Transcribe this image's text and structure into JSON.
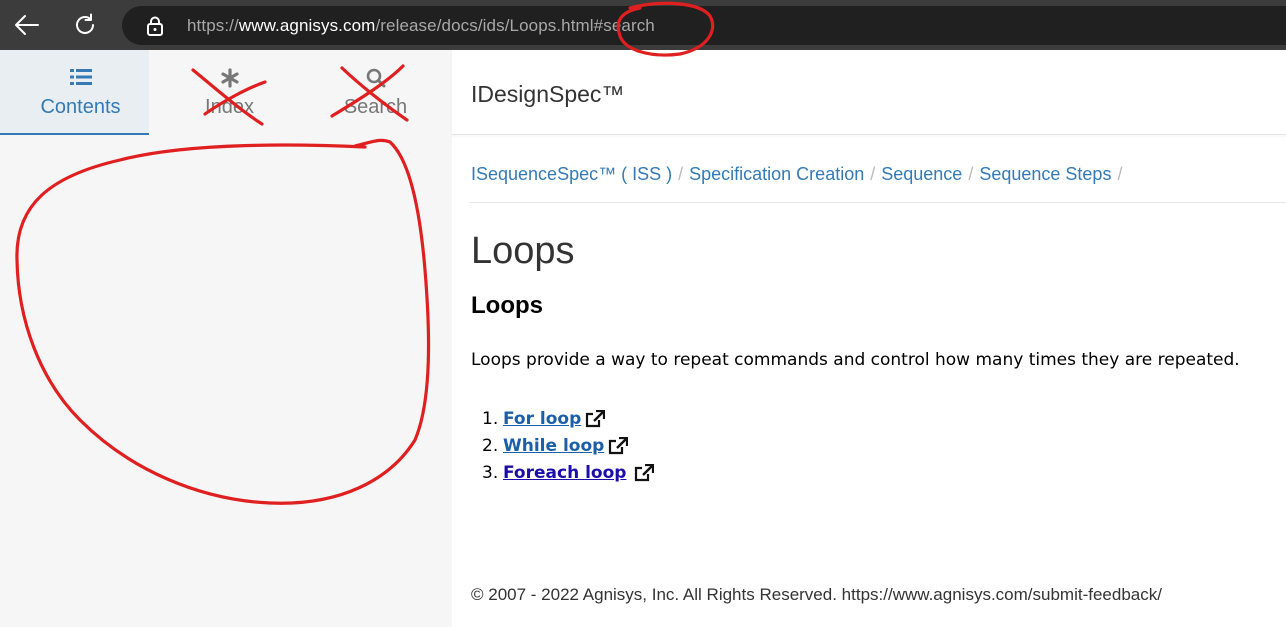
{
  "browser": {
    "url_prefix": "https://",
    "url_host": "www.agnisys.com",
    "url_path": "/release/docs/ids/Loops.html#search",
    "icons": [
      "back-arrow-icon",
      "reload-icon",
      "lock-icon"
    ]
  },
  "sidebar": {
    "tabs": [
      {
        "label": "Contents",
        "icon": "list-icon",
        "active": true
      },
      {
        "label": "Index",
        "icon": "asterisk-icon",
        "active": false
      },
      {
        "label": "Search",
        "icon": "search-icon",
        "active": false
      }
    ]
  },
  "header": {
    "title": "IDesignSpec™"
  },
  "breadcrumb": [
    "ISequenceSpec™ ( ISS )",
    "Specification Creation",
    "Sequence",
    "Sequence Steps"
  ],
  "page": {
    "title": "Loops",
    "section_title": "Loops",
    "intro": "Loops provide a way to repeat commands and control how many times they are repeated.",
    "list": [
      {
        "num": "1.",
        "label": "For loop ",
        "color": "#1a5fa8"
      },
      {
        "num": "2.",
        "label": "While loop ",
        "color": "#1a5fa8"
      },
      {
        "num": "3.",
        "label": "Foreach loop",
        "color": "#1a0dab"
      }
    ]
  },
  "footer": {
    "text": "© 2007 - 2022 Agnisys, Inc. All Rights Reserved. https://www.agnisys.com/submit-feedback/"
  },
  "colors": {
    "accent": "#337ab7",
    "annotation": "#e02020"
  }
}
